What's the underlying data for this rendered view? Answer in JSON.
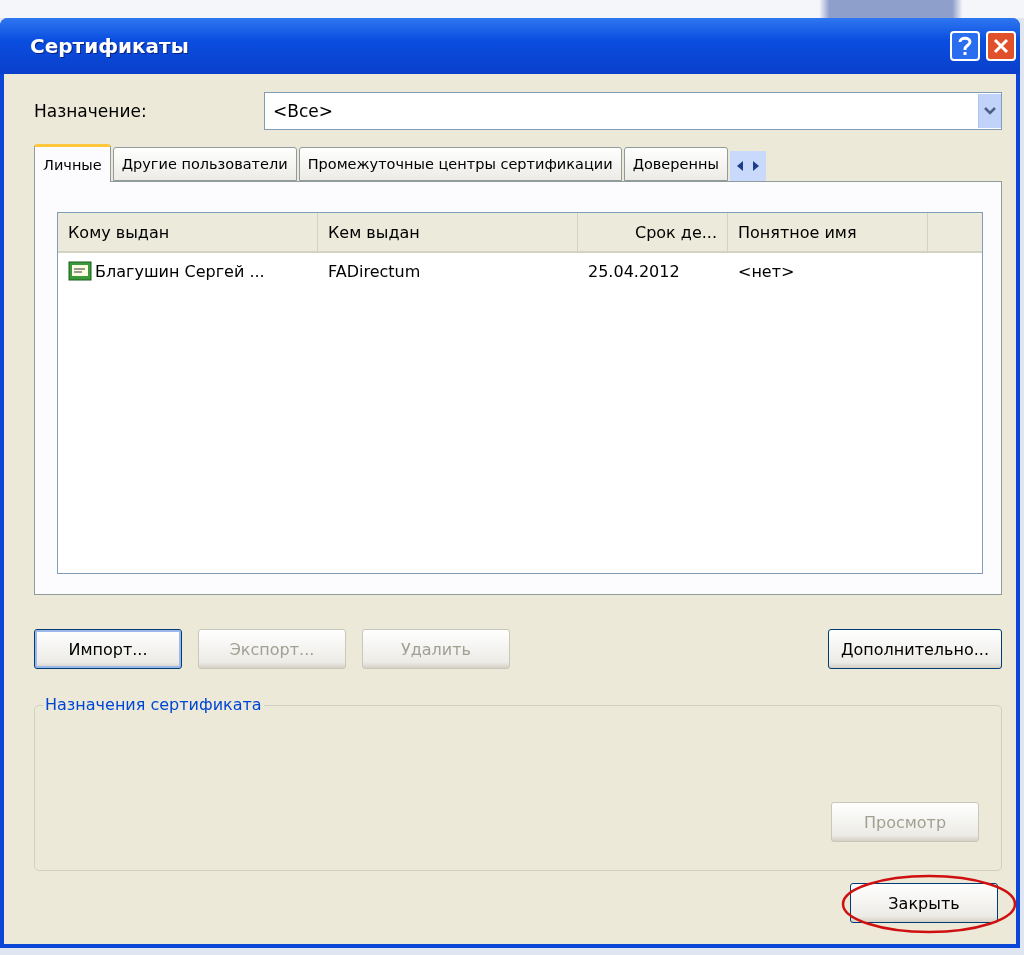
{
  "window": {
    "title": "Сертификаты"
  },
  "purpose": {
    "label": "Назначение:",
    "value": "<Все>"
  },
  "tabs": [
    {
      "label": "Личные",
      "selected": true
    },
    {
      "label": "Другие пользователи",
      "selected": false
    },
    {
      "label": "Промежуточные центры сертификации",
      "selected": false
    },
    {
      "label": "Доверенны",
      "selected": false
    }
  ],
  "table": {
    "columns": [
      "Кому выдан",
      "Кем выдан",
      "Срок де...",
      "Понятное имя"
    ],
    "rows": [
      {
        "cells": [
          "Благушин Сергей ...",
          "FADirectum",
          "25.04.2012",
          "<нет>"
        ],
        "selected": false
      }
    ]
  },
  "buttons": [
    {
      "label": "Импорт...",
      "disabled": false,
      "default": true
    },
    {
      "label": "Экспорт...",
      "disabled": true,
      "default": false
    },
    {
      "label": "Удалить",
      "disabled": true,
      "default": false
    }
  ],
  "advanced_button": {
    "label": "Дополнительно...",
    "disabled": false
  },
  "group": {
    "title": "Назначения сертификата",
    "view_button": {
      "label": "Просмотр",
      "disabled": true
    }
  },
  "close_button": {
    "label": "Закрыть",
    "highlighted": true
  }
}
